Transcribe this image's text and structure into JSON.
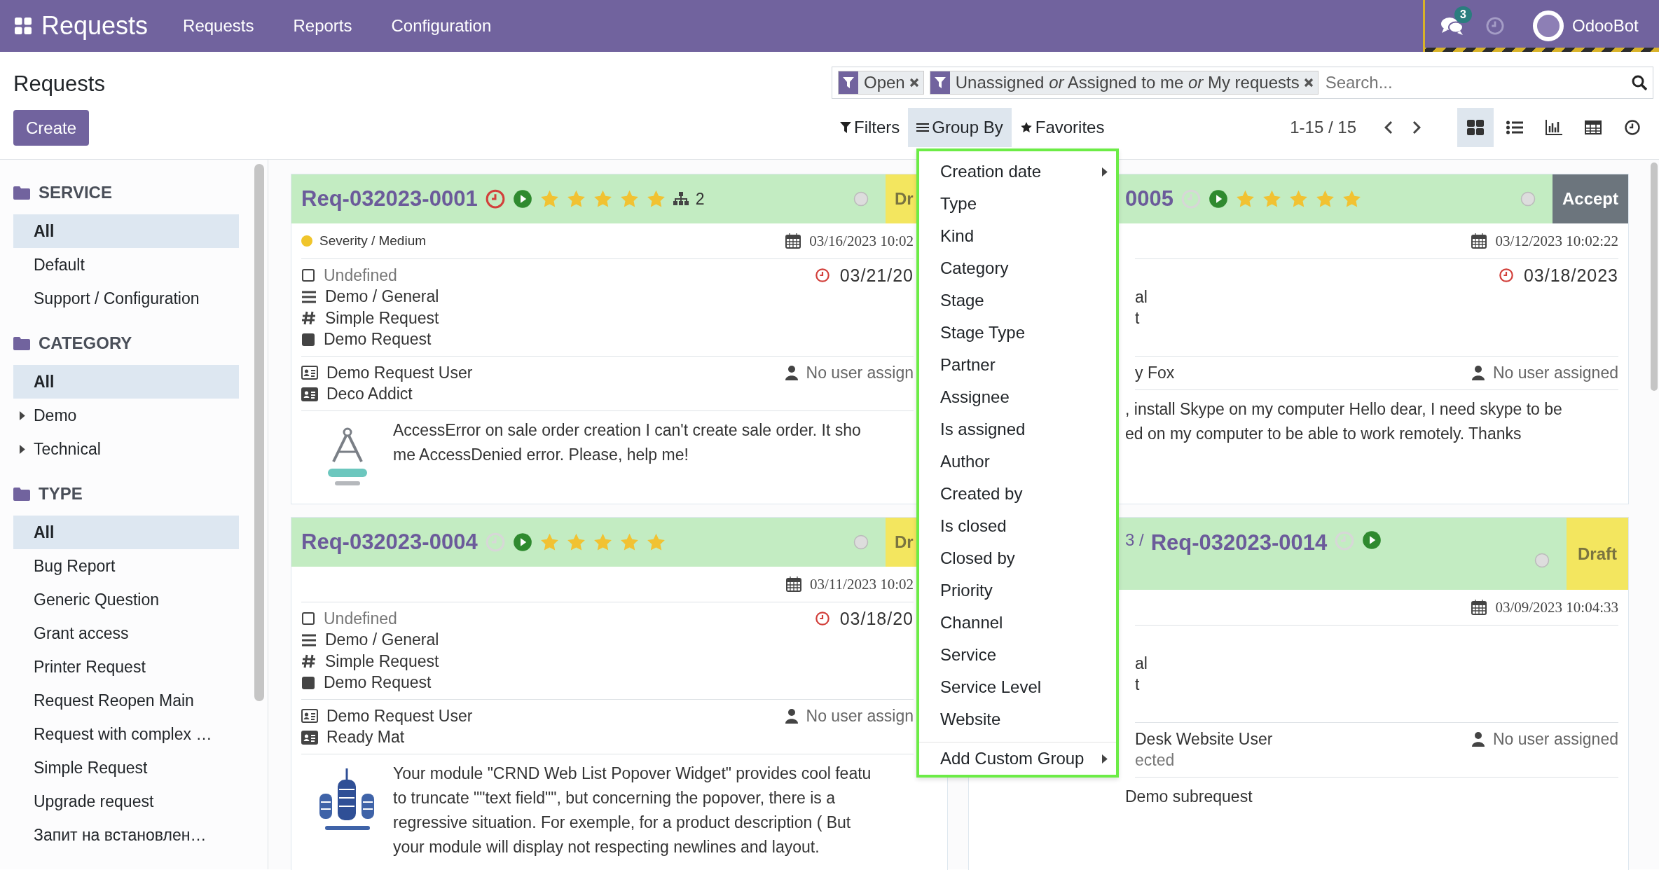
{
  "navbar": {
    "app_title": "Requests",
    "menu": [
      "Requests",
      "Reports",
      "Configuration"
    ],
    "messages_count": "3",
    "user": "OdooBot"
  },
  "page_title": "Requests",
  "create_button": "Create",
  "search": {
    "facets": [
      "Open",
      "Unassigned *or* Assigned to me *or* My requests"
    ],
    "placeholder": "Search..."
  },
  "search_buttons": [
    {
      "kind": "filters",
      "label": "Filters",
      "open": false
    },
    {
      "kind": "groupby",
      "label": "Group By",
      "open": true
    },
    {
      "kind": "favorites",
      "label": "Favorites",
      "open": false
    }
  ],
  "pager": "1-15 / 15",
  "views": [
    {
      "kind": "kanban",
      "selected": true
    },
    {
      "kind": "list",
      "selected": false
    },
    {
      "kind": "graph",
      "selected": false
    },
    {
      "kind": "pivot",
      "selected": false
    },
    {
      "kind": "activity",
      "selected": false
    }
  ],
  "sidebar": [
    {
      "title": "SERVICE",
      "items": [
        {
          "label": "All",
          "selected": true
        },
        {
          "label": "Default",
          "selected": false
        },
        {
          "label": "Support / Configuration",
          "selected": false
        }
      ]
    },
    {
      "title": "CATEGORY",
      "items": [
        {
          "label": "All",
          "selected": true
        },
        {
          "label": "Demo",
          "selected": false,
          "expanded": false
        },
        {
          "label": "Technical",
          "selected": false,
          "expanded": false
        }
      ]
    },
    {
      "title": "TYPE",
      "items": [
        {
          "label": "All",
          "selected": true
        },
        {
          "label": "Bug Report",
          "selected": false
        },
        {
          "label": "Generic Question",
          "selected": false
        },
        {
          "label": "Grant access",
          "selected": false
        },
        {
          "label": "Printer Request",
          "selected": false
        },
        {
          "label": "Request Reopen Main",
          "selected": false
        },
        {
          "label": "Request with complex …",
          "selected": false
        },
        {
          "label": "Simple Request",
          "selected": false
        },
        {
          "label": "Upgrade request",
          "selected": false
        },
        {
          "label": "Запит на встановлен…",
          "selected": false
        }
      ]
    }
  ],
  "cards": [
    {
      "title": "Req-032023-0001",
      "activity_overdue": true,
      "stars": 5,
      "subrequests": "2",
      "stage": {
        "label": "Dr",
        "color": "#f3e65f"
      },
      "severity": {
        "label": "Severity / Medium",
        "color": "#f0c52b"
      },
      "created": "03/16/2023 10:02",
      "deadline": "03/21/20",
      "lines": [
        {
          "kind": "undefined",
          "text": "Undefined"
        },
        {
          "kind": "category",
          "text": "Demo / General"
        },
        {
          "kind": "type",
          "text": "Simple Request"
        },
        {
          "kind": "request",
          "text": "Demo Request"
        }
      ],
      "people": [
        {
          "kind": "author",
          "text": "Demo Request User"
        },
        {
          "kind": "partner",
          "text": "Deco Addict"
        }
      ],
      "assignee": "No user assign",
      "image": {
        "kind": "picture"
      },
      "description": [
        "AccessError on sale order creation I can't create sale order. It sho",
        "me AccessDenied error. Please, help me!"
      ]
    },
    {
      "title": "0005",
      "activity_overdue": false,
      "stars": 5,
      "stage": {
        "label": "Accept",
        "color": "#6c757d"
      },
      "created": "03/12/2023 10:02:22",
      "deadline": "03/18/2023",
      "lines": [
        {
          "kind": "fragment",
          "text": "al"
        },
        {
          "kind": "fragment",
          "text": "t"
        }
      ],
      "people": [
        {
          "kind": "fragment",
          "text": "y Fox"
        }
      ],
      "assignee": "No user assigned",
      "description": [
        ", install Skype on my computer Hello dear, I need skype to be",
        "ed on my computer to be able to work remotely. Thanks"
      ]
    },
    {
      "title": "Req-032023-0004",
      "activity_overdue": false,
      "stars": 5,
      "stage": {
        "label": "Dr",
        "color": "#f3e65f"
      },
      "created": "03/11/2023 10:02",
      "deadline": "03/18/20",
      "lines": [
        {
          "kind": "undefined",
          "text": "Undefined"
        },
        {
          "kind": "category",
          "text": "Demo / General"
        },
        {
          "kind": "type",
          "text": "Simple Request"
        },
        {
          "kind": "request",
          "text": "Demo Request"
        }
      ],
      "people": [
        {
          "kind": "author",
          "text": "Demo Request User"
        },
        {
          "kind": "partner",
          "text": "Ready Mat"
        }
      ],
      "assignee": "No user assign",
      "image": {
        "kind": "picture"
      },
      "description": [
        "Your module \"CRND Web List Popover Widget\" provides cool featu",
        "to truncate \"\"text field\"\", but concerning the popover, there is a",
        "regressive situation. For exemple, for a product description ( But",
        "your module will display not respecting newlines and layout."
      ]
    },
    {
      "breadcrumb": "3 /",
      "title": "Req-032023-0014",
      "activity_overdue": false,
      "stage": {
        "label": "Draft",
        "color": "#f3e65f"
      },
      "created": "03/09/2023 10:04:33",
      "lines": [
        {
          "kind": "fragment",
          "text": "al"
        },
        {
          "kind": "fragment",
          "text": "t"
        }
      ],
      "people": [
        {
          "kind": "fragment",
          "text": "Desk Website User"
        },
        {
          "kind": "muted",
          "text": "ected"
        }
      ],
      "assignee": "No user assigned",
      "description": [
        "Demo subrequest"
      ]
    }
  ],
  "group_by_menu": {
    "items": [
      {
        "label": "Creation date",
        "submenu": true
      },
      {
        "label": "Type",
        "submenu": false
      },
      {
        "label": "Kind",
        "submenu": false
      },
      {
        "label": "Category",
        "submenu": false
      },
      {
        "label": "Stage",
        "submenu": false
      },
      {
        "label": "Stage Type",
        "submenu": false
      },
      {
        "label": "Partner",
        "submenu": false
      },
      {
        "label": "Assignee",
        "submenu": false
      },
      {
        "label": "Is assigned",
        "submenu": false
      },
      {
        "label": "Author",
        "submenu": false
      },
      {
        "label": "Created by",
        "submenu": false
      },
      {
        "label": "Is closed",
        "submenu": false
      },
      {
        "label": "Closed by",
        "submenu": false
      },
      {
        "label": "Priority",
        "submenu": false
      },
      {
        "label": "Channel",
        "submenu": false
      },
      {
        "label": "Service",
        "submenu": false
      },
      {
        "label": "Service Level",
        "submenu": false
      },
      {
        "label": "Website",
        "submenu": false
      }
    ],
    "custom_group": {
      "label": "Add Custom Group",
      "submenu": true
    }
  }
}
